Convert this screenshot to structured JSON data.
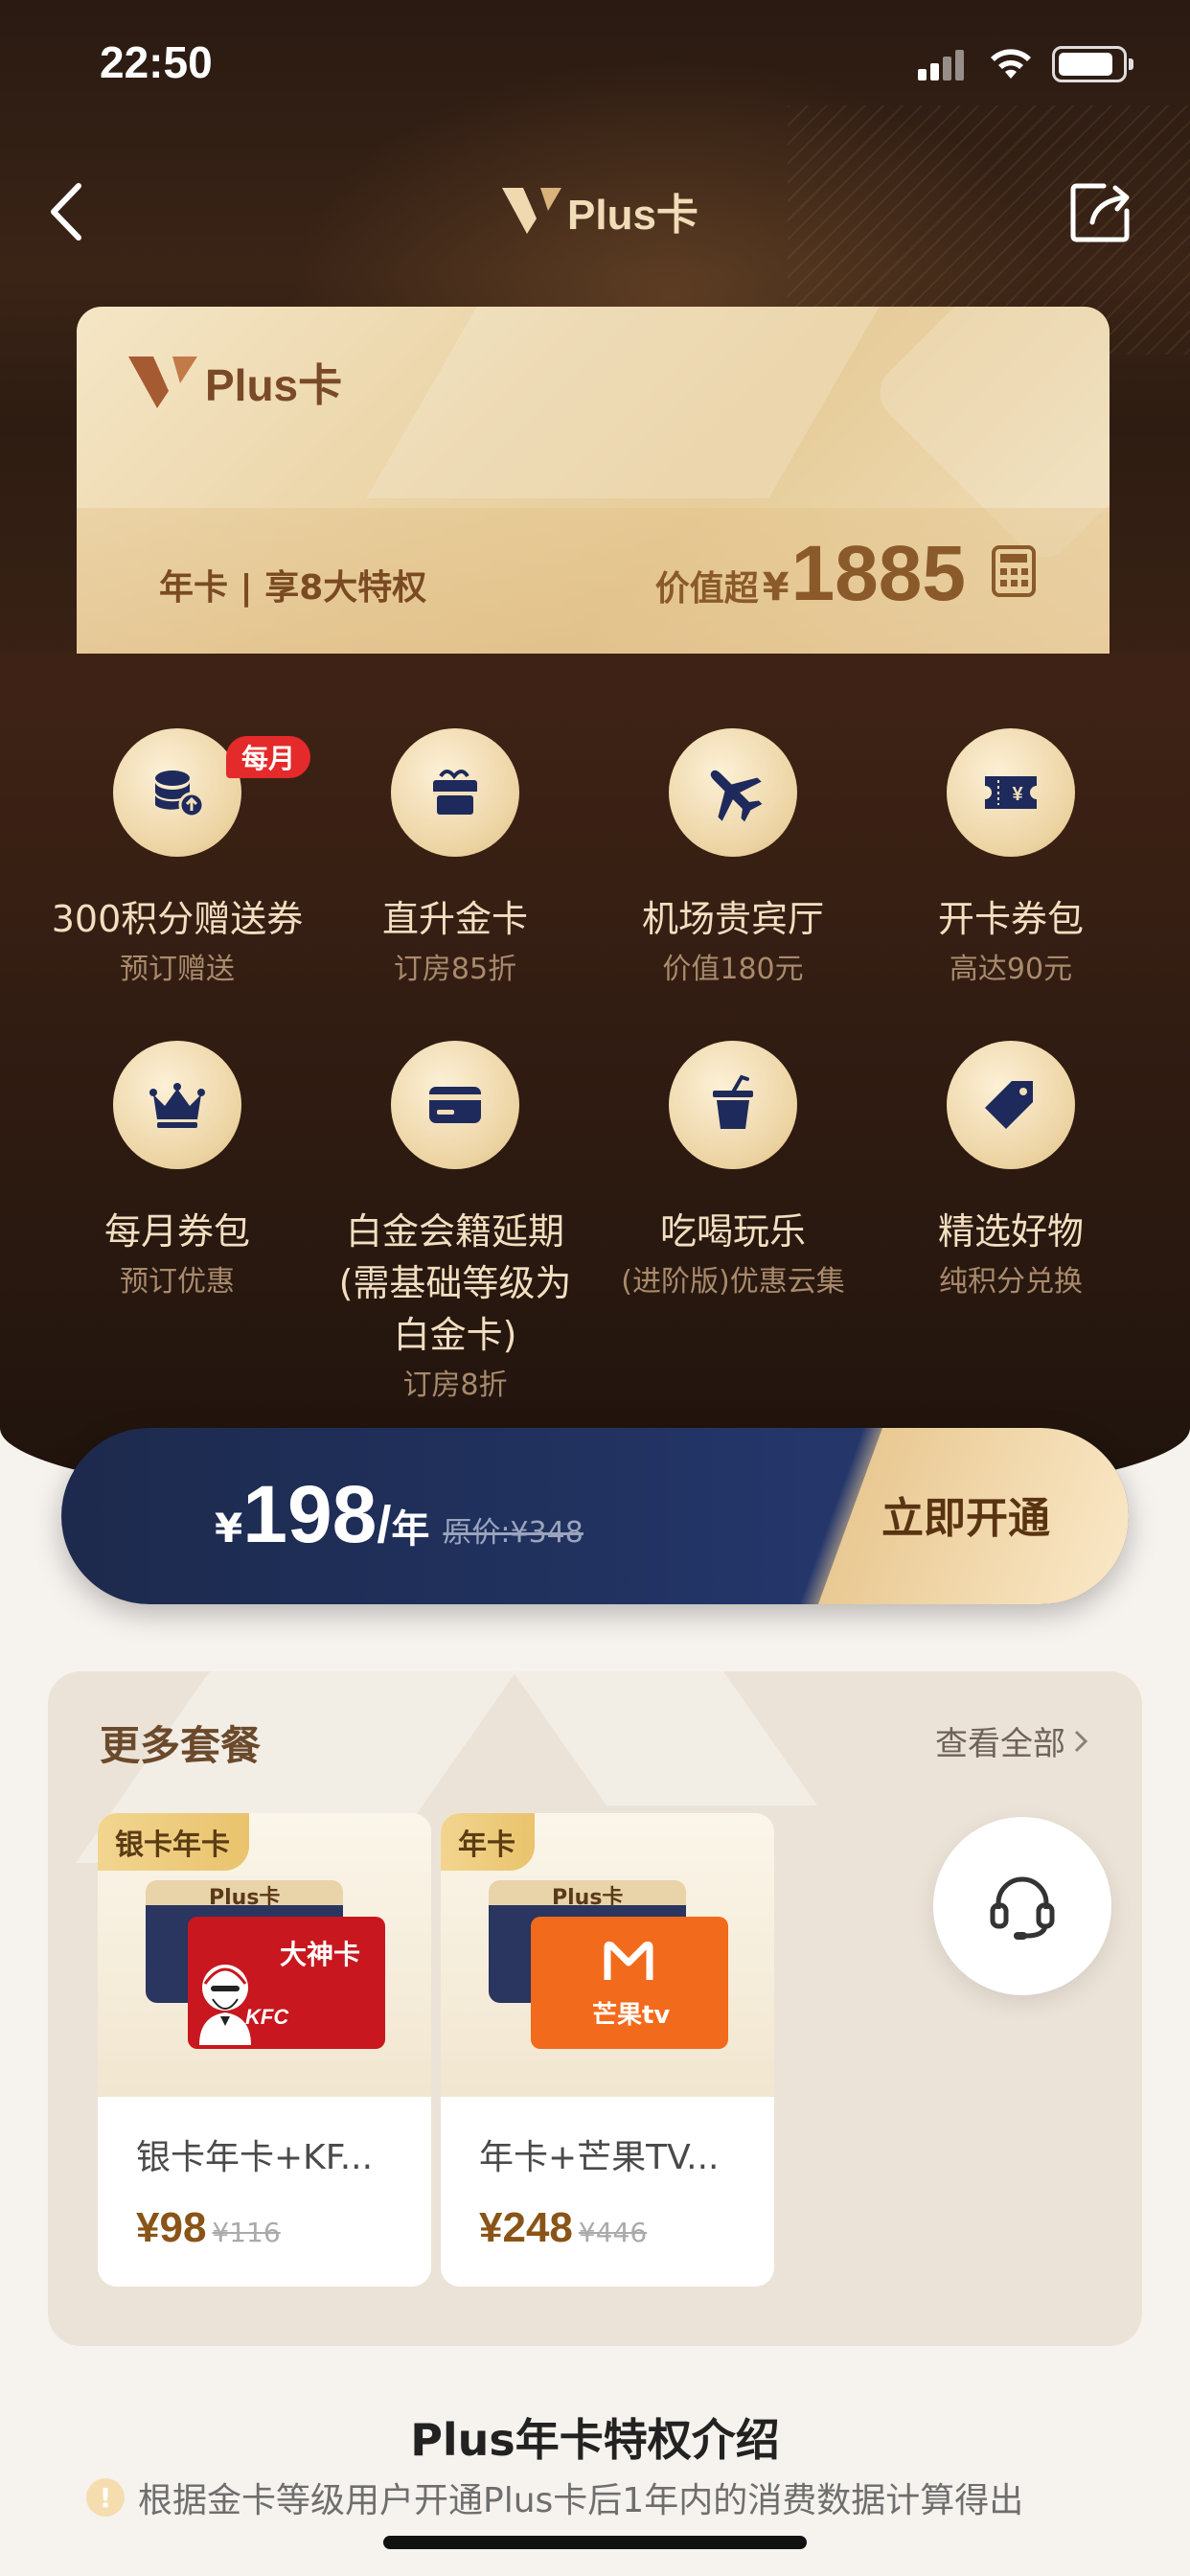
{
  "status_bar": {
    "time": "22:50"
  },
  "nav": {
    "title": "Plus卡"
  },
  "member_card": {
    "brand": "Plus卡",
    "description": "年卡 | 享8大特权",
    "value_label": "价值超",
    "value_currency": "¥",
    "value_amount": "1885"
  },
  "benefits": [
    {
      "title": "300积分赠送券",
      "sub": "预订赠送",
      "badge": "每月",
      "icon": "coin-stack-icon"
    },
    {
      "title": "直升金卡",
      "sub": "订房85折",
      "icon": "gift-box-icon"
    },
    {
      "title": "机场贵宾厅",
      "sub": "价值180元",
      "icon": "airplane-icon"
    },
    {
      "title": "开卡券包",
      "sub": "高达90元",
      "icon": "ticket-icon",
      "icon_text": "¥"
    },
    {
      "title": "每月券包",
      "sub": "预订优惠",
      "icon": "crown-icon"
    },
    {
      "title": "白金会籍延期",
      "title2": "(需基础等级为",
      "title3": "白金卡)",
      "sub": "订房8折",
      "icon": "card-icon"
    },
    {
      "title": "吃喝玩乐",
      "sub": "(进阶版)优惠云集",
      "icon": "drink-cup-icon"
    },
    {
      "title": "精选好物",
      "sub": "纯积分兑换",
      "icon": "tag-icon"
    }
  ],
  "price_bar": {
    "currency": "¥",
    "amount": "198",
    "slash": "/",
    "period": "年",
    "original": "原价:¥348",
    "cta": "立即开通"
  },
  "more_packages": {
    "title": "更多套餐",
    "view_all": "查看全部",
    "items": [
      {
        "tag": "银卡年卡",
        "back_card": "Plus卡",
        "front_card": "大神卡",
        "front_sub": "KFC",
        "name": "银卡年卡+KF...",
        "price": "¥98",
        "original": "¥116"
      },
      {
        "tag": "年卡",
        "back_card": "Plus卡",
        "front_card": "芒果tv",
        "name": "年卡+芒果TV...",
        "price": "¥248",
        "original": "¥446"
      }
    ]
  },
  "intro": {
    "title": "Plus年卡特权介绍",
    "note": "根据金卡等级用户开通Plus卡后1年内的消费数据计算得出"
  },
  "colors": {
    "dark_bg": "#2a1a12",
    "gold": "#ecd3a2",
    "navy": "#213260",
    "icon_navy": "#1f2a5c",
    "badge_red": "#e42a2a"
  }
}
